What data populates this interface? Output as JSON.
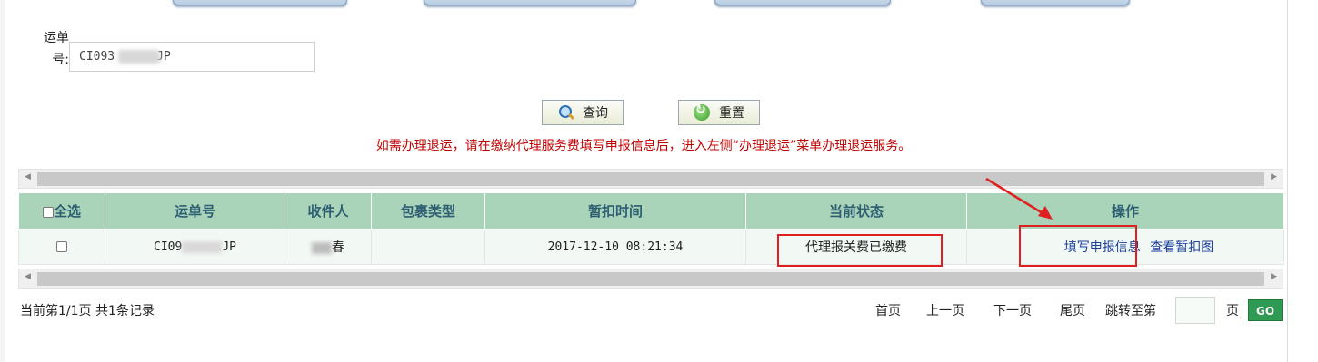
{
  "search": {
    "label": "运单号:",
    "value_prefix": "CI093",
    "value_suffix": "JP"
  },
  "buttons": {
    "query": "查询",
    "reset": "重置"
  },
  "notice": "如需办理退运，请在缴纳代理服务费填写申报信息后，进入左侧“办理退运”菜单办理退运服务。",
  "table": {
    "headers": {
      "select_all": "全选",
      "waybill": "运单号",
      "recipient": "收件人",
      "package_type": "包裹类型",
      "detain_time": "暂扣时间",
      "status": "当前状态",
      "action": "操作"
    },
    "rows": [
      {
        "waybill_prefix": "CI09",
        "waybill_suffix": "JP",
        "recipient_suffix": "春",
        "package_type": "",
        "detain_time": "2017-12-10 08:21:34",
        "status": "代理报关费已缴费",
        "action_fill": "填写申报信息",
        "action_view": "查看暂扣图"
      }
    ]
  },
  "pager": {
    "info": "当前第1/1页 共1条记录",
    "first": "首页",
    "prev": "上一页",
    "next": "下一页",
    "last": "尾页",
    "jump_to": "跳转至第",
    "page_unit": "页",
    "go": "GO"
  },
  "colors": {
    "header_bg": "#a9d4b9",
    "notice": "#c00000",
    "highlight": "#e02020",
    "go_button": "#2e9a53"
  },
  "icons": [
    "search-icon",
    "reset-icon",
    "checkbox-icon",
    "arrow-annotation-icon"
  ]
}
